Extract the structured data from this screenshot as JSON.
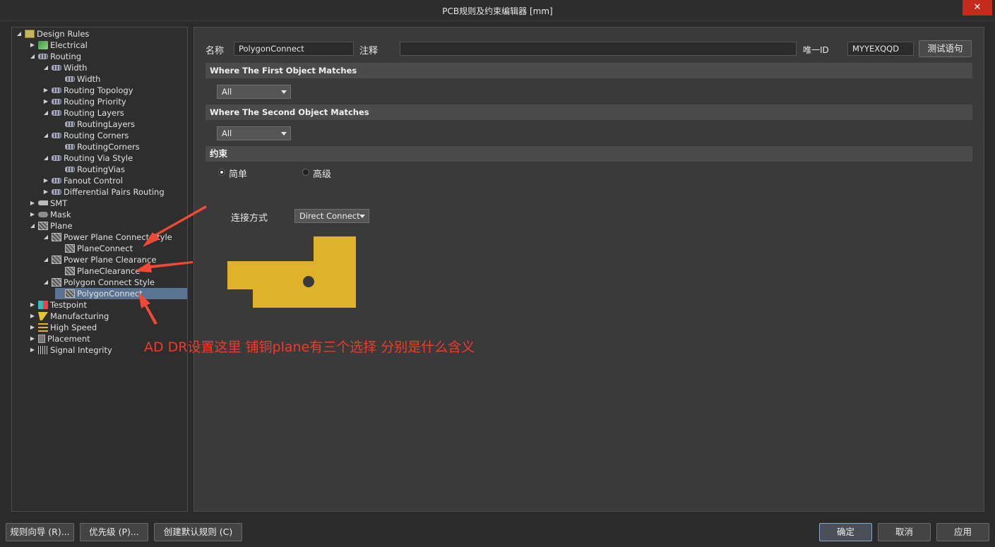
{
  "window": {
    "title": "PCB规则及约束编辑器 [mm]",
    "close_glyph": "✕"
  },
  "tree": [
    {
      "label": "Design Rules",
      "depth": 0,
      "arrow": "◢",
      "icon": "folder-icon"
    },
    {
      "label": "Electrical",
      "depth": 1,
      "arrow": "▶",
      "icon": "electrical-icon"
    },
    {
      "label": "Routing",
      "depth": 1,
      "arrow": "◢",
      "icon": "rule-icon"
    },
    {
      "label": "Width",
      "depth": 2,
      "arrow": "◢",
      "icon": "rule-icon"
    },
    {
      "label": "Width",
      "depth": 3,
      "arrow": "",
      "icon": "rule-icon"
    },
    {
      "label": "Routing Topology",
      "depth": 2,
      "arrow": "▶",
      "icon": "rule-icon"
    },
    {
      "label": "Routing Priority",
      "depth": 2,
      "arrow": "▶",
      "icon": "rule-icon"
    },
    {
      "label": "Routing Layers",
      "depth": 2,
      "arrow": "◢",
      "icon": "rule-icon"
    },
    {
      "label": "RoutingLayers",
      "depth": 3,
      "arrow": "",
      "icon": "rule-icon"
    },
    {
      "label": "Routing Corners",
      "depth": 2,
      "arrow": "◢",
      "icon": "rule-icon"
    },
    {
      "label": "RoutingCorners",
      "depth": 3,
      "arrow": "",
      "icon": "rule-icon"
    },
    {
      "label": "Routing Via Style",
      "depth": 2,
      "arrow": "◢",
      "icon": "rule-icon"
    },
    {
      "label": "RoutingVias",
      "depth": 3,
      "arrow": "",
      "icon": "rule-icon"
    },
    {
      "label": "Fanout Control",
      "depth": 2,
      "arrow": "▶",
      "icon": "rule-icon"
    },
    {
      "label": "Differential Pairs Routing",
      "depth": 2,
      "arrow": "▶",
      "icon": "rule-icon"
    },
    {
      "label": "SMT",
      "depth": 1,
      "arrow": "▶",
      "icon": "smt-icon"
    },
    {
      "label": "Mask",
      "depth": 1,
      "arrow": "▶",
      "icon": "mask-icon"
    },
    {
      "label": "Plane",
      "depth": 1,
      "arrow": "◢",
      "icon": "plane-icon"
    },
    {
      "label": "Power Plane Connect Style",
      "depth": 2,
      "arrow": "◢",
      "icon": "plane-icon"
    },
    {
      "label": "PlaneConnect",
      "depth": 3,
      "arrow": "",
      "icon": "plane-icon"
    },
    {
      "label": "Power Plane Clearance",
      "depth": 2,
      "arrow": "◢",
      "icon": "plane-icon"
    },
    {
      "label": "PlaneClearance",
      "depth": 3,
      "arrow": "",
      "icon": "plane-icon"
    },
    {
      "label": "Polygon Connect Style",
      "depth": 2,
      "arrow": "◢",
      "icon": "plane-icon"
    },
    {
      "label": "PolygonConnect",
      "depth": 3,
      "arrow": "",
      "icon": "plane-icon",
      "selected": true
    },
    {
      "label": "Testpoint",
      "depth": 1,
      "arrow": "▶",
      "icon": "testpoint-icon"
    },
    {
      "label": "Manufacturing",
      "depth": 1,
      "arrow": "▶",
      "icon": "manufacturing-icon"
    },
    {
      "label": "High Speed",
      "depth": 1,
      "arrow": "▶",
      "icon": "high-speed-icon"
    },
    {
      "label": "Placement",
      "depth": 1,
      "arrow": "▶",
      "icon": "placement-icon"
    },
    {
      "label": "Signal Integrity",
      "depth": 1,
      "arrow": "▶",
      "icon": "signal-integrity-icon"
    }
  ],
  "form": {
    "name_label": "名称",
    "name_value": "PolygonConnect",
    "comment_label": "注释",
    "comment_value": "",
    "uid_label": "唯一ID",
    "uid_value": "MYYEXQQD",
    "test_button": "测试语句",
    "first_match_title": "Where The First Object Matches",
    "first_match_value": "All",
    "second_match_title": "Where The Second Object Matches",
    "second_match_value": "All",
    "constraint_title": "约束",
    "radio_simple": "简单",
    "radio_advanced": "高级",
    "connect_label": "连接方式",
    "connect_value": "Direct Connect"
  },
  "annotation": {
    "text": "AD DR设置这里 铺铜plane有三个选择  分别是什么含义",
    "color": "#f03a2a"
  },
  "bottom": {
    "wizard": "规则向导 (R)...",
    "priority": "优先级 (P)...",
    "create_default": "创建默认规则 (C)",
    "ok": "确定",
    "cancel": "取消",
    "apply": "应用"
  },
  "colors": {
    "polygon": "#e0b22a",
    "via": "#3a3a3a",
    "selected_row": "#5b7392"
  }
}
